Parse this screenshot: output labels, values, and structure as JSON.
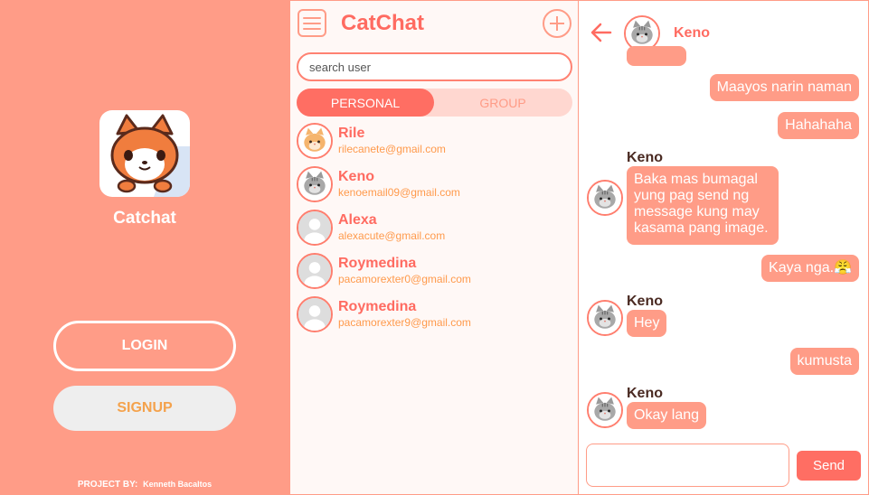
{
  "welcome": {
    "app_name": "Catchat",
    "login_label": "LOGIN",
    "signup_label": "SIGNUP",
    "credits_prefix": "PROJECT BY:",
    "credits_author": "Kenneth Bacaltos"
  },
  "contacts_panel": {
    "brand": "CatChat",
    "search_placeholder": "search user",
    "tabs": [
      {
        "label": "PERSONAL",
        "active": true
      },
      {
        "label": "GROUP",
        "active": false
      }
    ],
    "items": [
      {
        "name": "Rile",
        "email": "rilecanete@gmail.com",
        "avatar": "orange-cat-icon"
      },
      {
        "name": "Keno",
        "email": "kenoemail09@gmail.com",
        "avatar": "gray-cat-icon"
      },
      {
        "name": "Alexa",
        "email": "alexacute@gmail.com",
        "avatar": "default-user-icon"
      },
      {
        "name": "Roymedina",
        "email": "pacamorexter0@gmail.com",
        "avatar": "default-user-icon"
      },
      {
        "name": "Roymedina",
        "email": "pacamorexter9@gmail.com",
        "avatar": "default-user-icon"
      }
    ]
  },
  "chat": {
    "title": "Keno",
    "messages": [
      {
        "from": "me",
        "text": "Maayos narin naman"
      },
      {
        "from": "me",
        "text": "Hahahaha"
      },
      {
        "from": "Keno",
        "text": "Baka mas bumagal yung pag send ng message kung may kasama pang image."
      },
      {
        "from": "me",
        "text": "Kaya nga.😤"
      },
      {
        "from": "Keno",
        "text": "Hey"
      },
      {
        "from": "me",
        "text": "kumusta"
      },
      {
        "from": "Keno",
        "text": "Okay lang"
      }
    ],
    "send_label": "Send",
    "input_value": ""
  },
  "colors": {
    "panel_bg": "#ff9c87",
    "accent": "#ff6e63",
    "bubble": "#ff9c87",
    "email": "#ff9a4c"
  }
}
